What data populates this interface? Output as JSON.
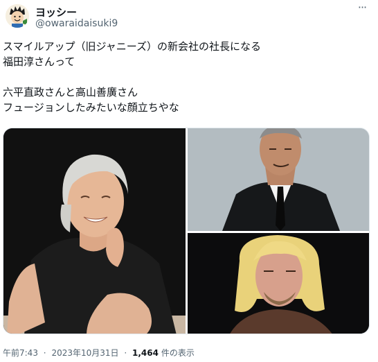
{
  "tweet": {
    "display_name": "ヨッシー",
    "handle": "@owaraidaisuki9",
    "more_label": "···",
    "text_lines": [
      "スマイルアップ（旧ジャニーズ）の新会社の社長になる",
      "福田淳さんって",
      "",
      "六平直政さんと高山善廣さん",
      "フュージョンしたみたいな顔立ちやな"
    ],
    "timestamp_time": "午前7:43",
    "timestamp_date": "2023年10月31日",
    "views_count": "1,464",
    "views_label": "件の表示",
    "separator": "·"
  },
  "colors": {
    "text_primary": "#0f1419",
    "text_secondary": "#536471",
    "background": "#ffffff"
  },
  "icons": {
    "avatar": "cartoon-avatar-icon",
    "more": "more-options-icon"
  }
}
